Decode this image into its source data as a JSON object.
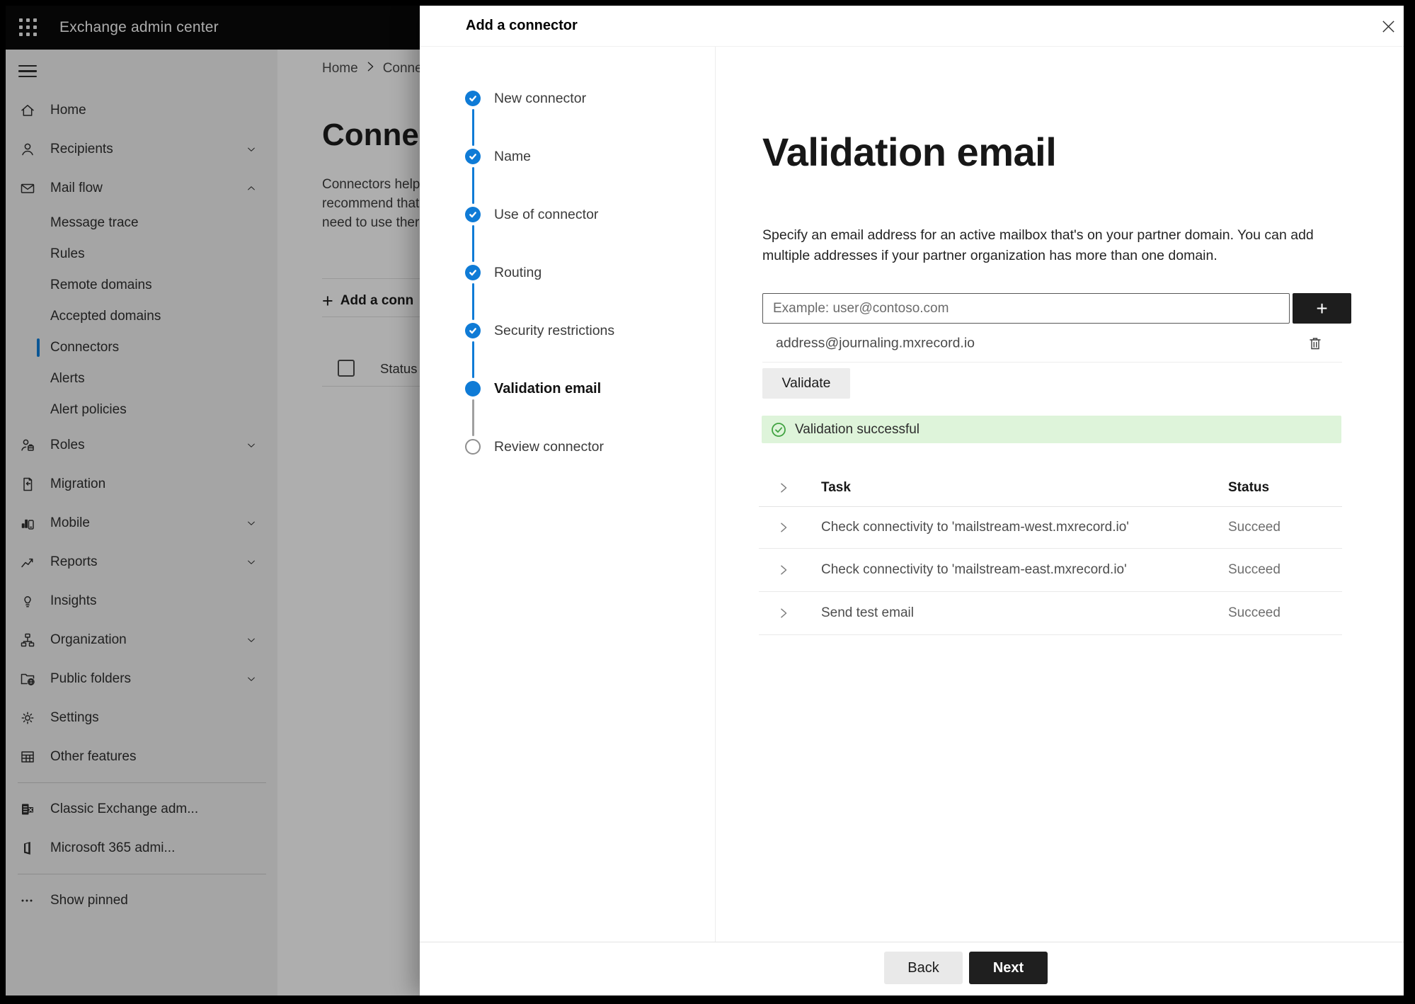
{
  "topbar": {
    "title": "Exchange admin center"
  },
  "colors": {
    "accent_blue": "#0f7bd6",
    "topbar_bg": "#0a0a0a",
    "success_banner_bg": "#def4da",
    "success_icon_green": "#41a341",
    "next_button_bg": "#1f1f1f"
  },
  "sidebar": {
    "items": [
      {
        "type": "main",
        "label": "Home",
        "icon": "home"
      },
      {
        "type": "main",
        "label": "Recipients",
        "icon": "person",
        "chevron": "down"
      },
      {
        "type": "main",
        "label": "Mail flow",
        "icon": "mail",
        "chevron": "up"
      },
      {
        "type": "sub",
        "label": "Message trace"
      },
      {
        "type": "sub",
        "label": "Rules"
      },
      {
        "type": "sub",
        "label": "Remote domains"
      },
      {
        "type": "sub",
        "label": "Accepted domains"
      },
      {
        "type": "sub",
        "label": "Connectors",
        "selected": true
      },
      {
        "type": "sub",
        "label": "Alerts"
      },
      {
        "type": "sub",
        "label": "Alert policies"
      },
      {
        "type": "main",
        "label": "Roles",
        "icon": "person-badge",
        "chevron": "down"
      },
      {
        "type": "main",
        "label": "Migration",
        "icon": "document"
      },
      {
        "type": "main",
        "label": "Mobile",
        "icon": "mobile",
        "chevron": "down"
      },
      {
        "type": "main",
        "label": "Reports",
        "icon": "chart",
        "chevron": "down"
      },
      {
        "type": "main",
        "label": "Insights",
        "icon": "lightbulb"
      },
      {
        "type": "main",
        "label": "Organization",
        "icon": "org",
        "chevron": "down"
      },
      {
        "type": "main",
        "label": "Public folders",
        "icon": "folder-globe",
        "chevron": "down"
      },
      {
        "type": "main",
        "label": "Settings",
        "icon": "gear"
      },
      {
        "type": "main",
        "label": "Other features",
        "icon": "grid"
      },
      {
        "type": "divider"
      },
      {
        "type": "main",
        "label": "Classic Exchange adm...",
        "icon": "exchange-logo"
      },
      {
        "type": "main",
        "label": "Microsoft 365 admi...",
        "icon": "m365-logo"
      },
      {
        "type": "divider"
      },
      {
        "type": "main",
        "label": "Show pinned",
        "icon": "ellipsis"
      }
    ]
  },
  "background_page": {
    "breadcrumb": {
      "home": "Home",
      "current": "Conne"
    },
    "heading": "Connec",
    "para_lines": [
      "Connectors help",
      "recommend that",
      "need to use ther"
    ],
    "add_button_label": "Add a conn",
    "status_header": "Status"
  },
  "dialog": {
    "title": "Add a connector",
    "steps": [
      {
        "label": "New connector",
        "state": "done"
      },
      {
        "label": "Name",
        "state": "done"
      },
      {
        "label": "Use of connector",
        "state": "done"
      },
      {
        "label": "Routing",
        "state": "done"
      },
      {
        "label": "Security restrictions",
        "state": "done"
      },
      {
        "label": "Validation email",
        "state": "current"
      },
      {
        "label": "Review connector",
        "state": "upcoming"
      }
    ],
    "content": {
      "heading": "Validation email",
      "description": "Specify an email address for an active mailbox that's on your partner domain. You can add multiple addresses if your partner organization has more than one domain.",
      "input_placeholder": "Example: user@contoso.com",
      "add_address_label": "+",
      "address": "address@journaling.mxrecord.io",
      "validate_label": "Validate",
      "banner_text": "Validation successful",
      "table": {
        "columns": [
          "Task",
          "Status"
        ],
        "rows": [
          {
            "task": "Check connectivity to 'mailstream-west.mxrecord.io'",
            "status": "Succeed"
          },
          {
            "task": "Check connectivity to 'mailstream-east.mxrecord.io'",
            "status": "Succeed"
          },
          {
            "task": "Send test email",
            "status": "Succeed"
          }
        ]
      }
    },
    "footer": {
      "back_label": "Back",
      "next_label": "Next"
    }
  }
}
